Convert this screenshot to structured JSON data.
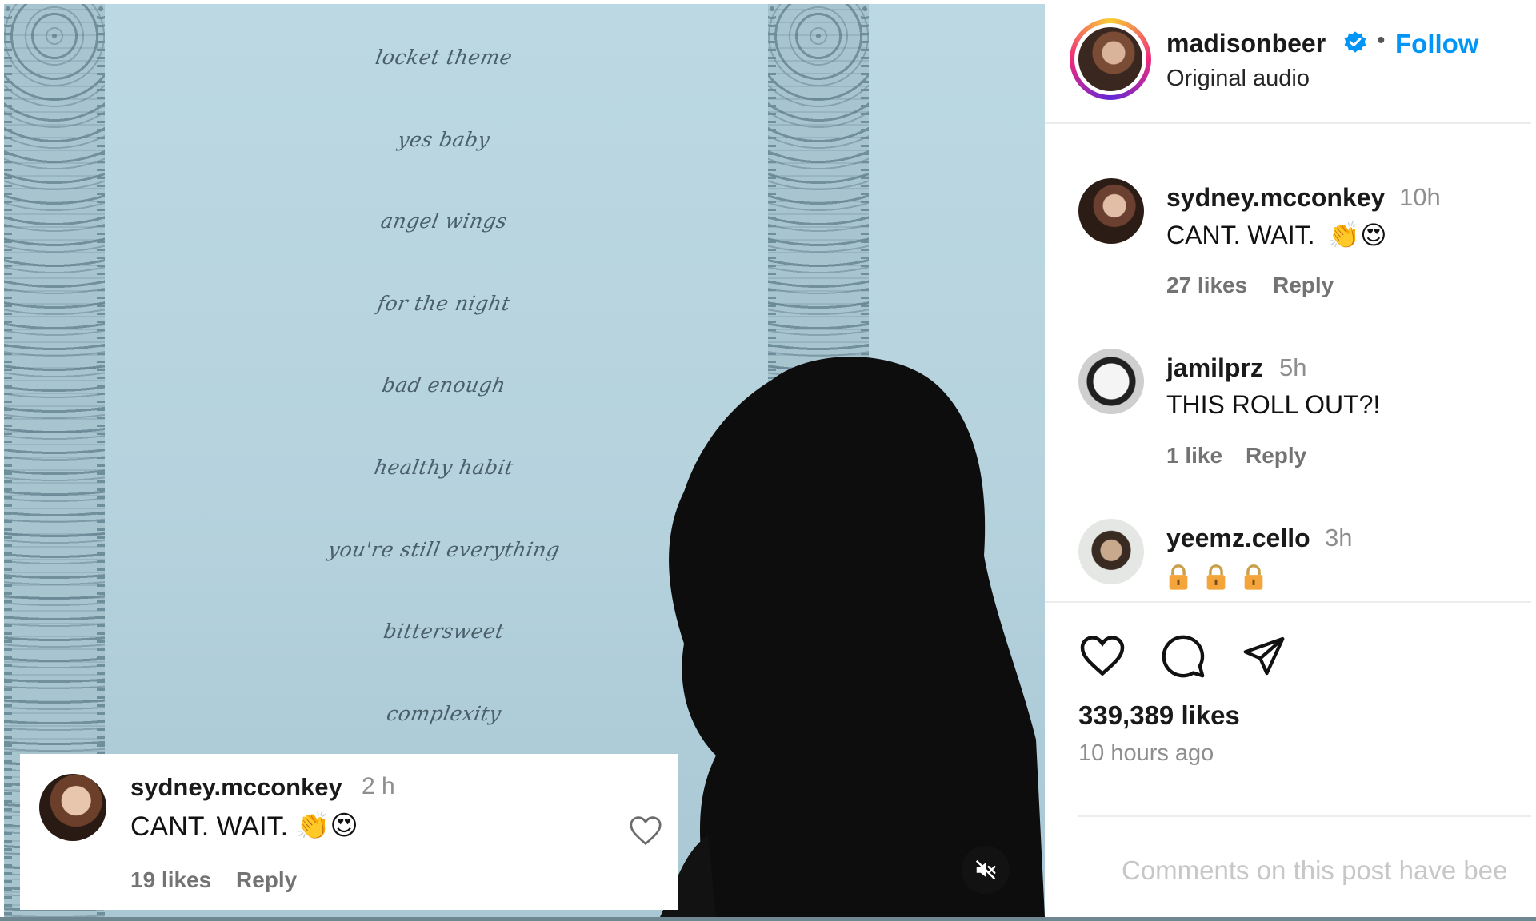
{
  "media": {
    "tracklist": [
      "locket theme",
      "yes baby",
      "angel wings",
      "for the night",
      "bad enough",
      "healthy habit",
      "you're still everything",
      "bittersweet",
      "complexity"
    ],
    "mute_icon": "speaker-muted-icon",
    "overlay_comment": {
      "username": "sydney.mcconkey",
      "time": "2 h",
      "text": "CANT. WAIT.",
      "emoji": "👏😍",
      "likes": "19 likes",
      "reply": "Reply",
      "heart_icon": "heart-outline-icon"
    }
  },
  "header": {
    "username": "madisonbeer",
    "verified_icon": "verified-badge-icon",
    "separator": "•",
    "follow": "Follow",
    "audio": "Original audio"
  },
  "comments": [
    {
      "username": "sydney.mcconkey",
      "time": "10h",
      "text": "CANT. WAIT.",
      "emoji": "👏😍",
      "likes": "27 likes",
      "reply": "Reply"
    },
    {
      "username": "jamilprz",
      "time": "5h",
      "text": "THIS ROLL OUT?!",
      "likes": "1 like",
      "reply": "Reply"
    },
    {
      "username": "yeemz.cello",
      "time": "3h",
      "text": "",
      "lock_icons": [
        "lock-icon",
        "lock-icon",
        "lock-icon"
      ]
    }
  ],
  "actions": {
    "like_icon": "heart-outline-icon",
    "comment_icon": "comment-bubble-icon",
    "share_icon": "paper-plane-icon"
  },
  "post": {
    "likes": "339,389 likes",
    "time": "10 hours ago",
    "comments_disabled": "Comments on this post have bee"
  },
  "colors": {
    "accent": "#0095f6",
    "muted": "#8e8e8e",
    "media_bg": "#bcd9e3"
  }
}
